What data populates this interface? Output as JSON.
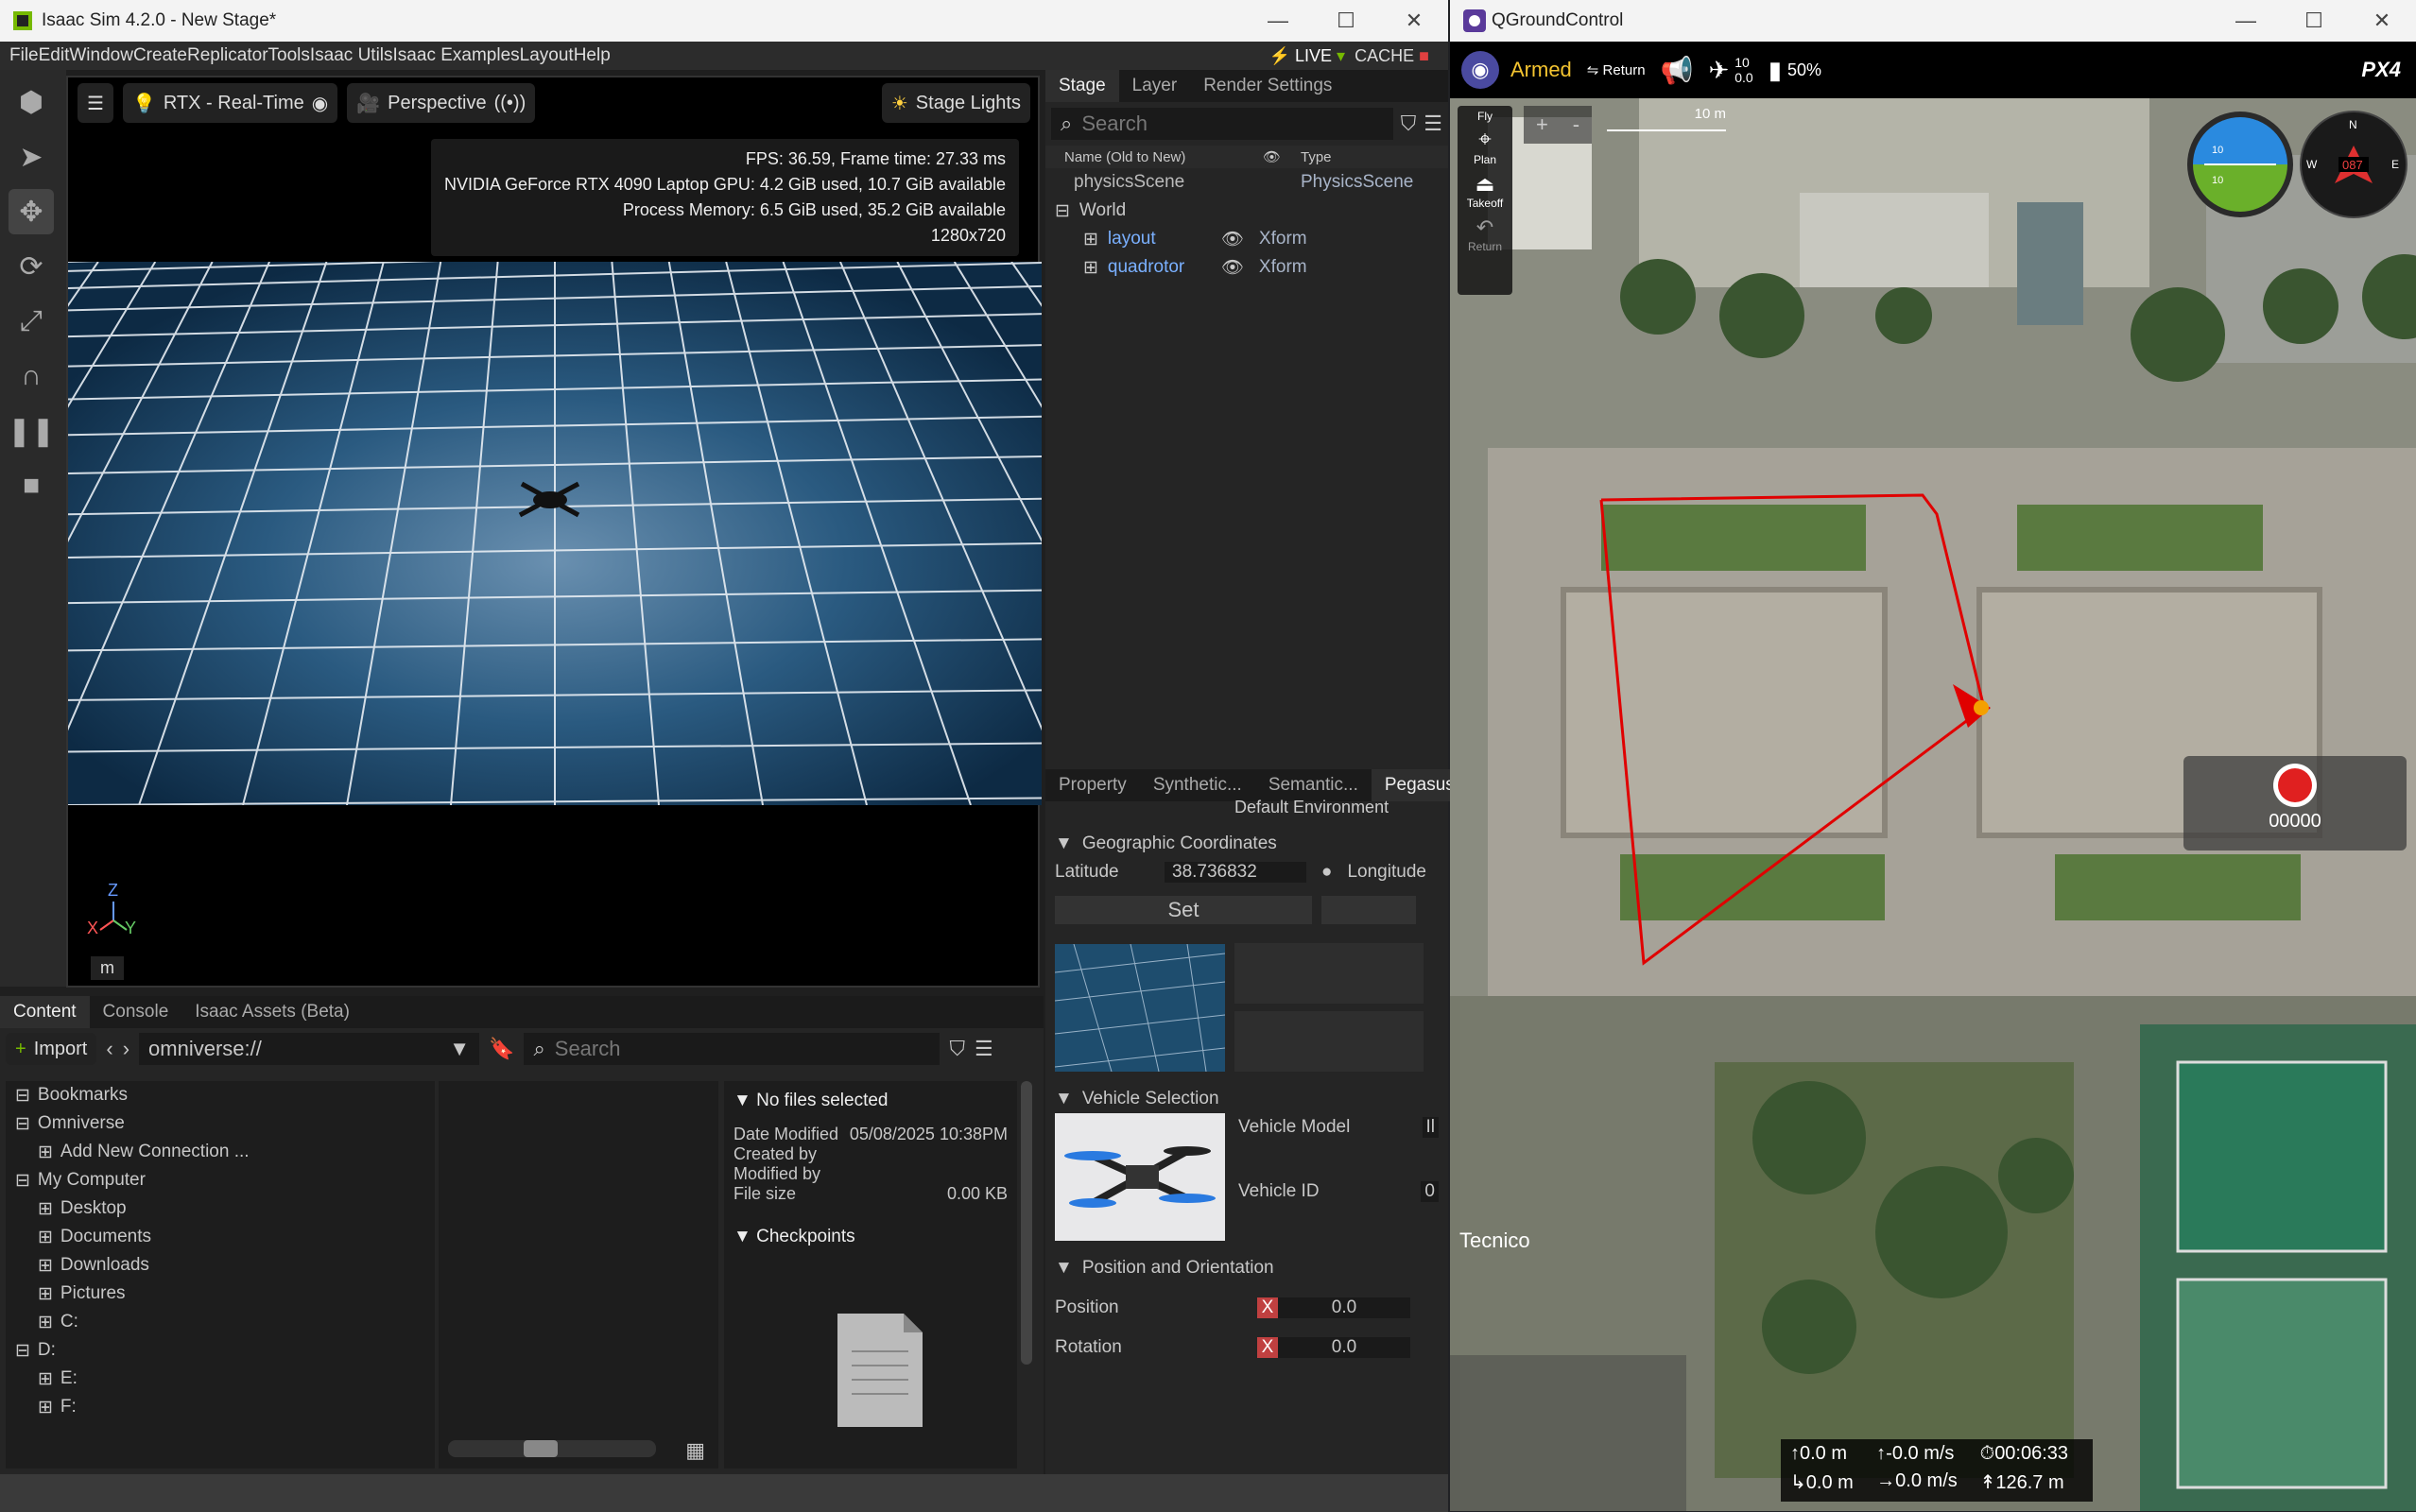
{
  "isaac": {
    "title": "Isaac Sim 4.2.0 - New Stage*",
    "menu": [
      "File",
      "Edit",
      "Window",
      "Create",
      "Replicator",
      "Tools",
      "Isaac Utils",
      "Isaac Examples",
      "Layout",
      "Help"
    ],
    "live": "LIVE",
    "cache": "CACHE",
    "viewport": {
      "renderer": "RTX - Real-Time",
      "camera": "Perspective",
      "lights": "Stage Lights",
      "stats": [
        "FPS: 36.59, Frame time: 27.33 ms",
        "NVIDIA GeForce RTX 4090 Laptop GPU: 4.2 GiB used, 10.7 GiB available",
        "Process Memory: 6.5 GiB used, 35.2 GiB available",
        "1280x720"
      ],
      "axes": {
        "z": "Z",
        "x": "X",
        "y": "Y"
      },
      "unit": "m"
    },
    "stage": {
      "tabs": [
        "Stage",
        "Layer",
        "Render Settings"
      ],
      "search": "Search",
      "col_name": "Name (Old to New)",
      "col_type": "Type",
      "items": [
        {
          "name": "physicsScene",
          "type": "PhysicsScene"
        },
        {
          "name": "World",
          "type": ""
        },
        {
          "name": "layout",
          "type": "Xform"
        },
        {
          "name": "quadrotor",
          "type": "Xform"
        }
      ]
    },
    "props": {
      "tabs": [
        "Property",
        "Synthetic...",
        "Semantic...",
        "Pegasus..."
      ],
      "env_partial": "Default Environment",
      "geo_header": "Geographic Coordinates",
      "lat_label": "Latitude",
      "lat_value": "38.736832",
      "lon_label": "Longitude",
      "set": "Set",
      "vehicle_header": "Vehicle Selection",
      "vehicle_model": "Vehicle Model",
      "vehicle_id": "Vehicle ID",
      "vehicle_model_partial": "Il",
      "vehicle_id_partial": "0",
      "pos_header": "Position and Orientation",
      "position": "Position",
      "rotation": "Rotation",
      "pos_val": "0.0",
      "rot_val": "0.0",
      "x": "X"
    },
    "content": {
      "tabs": [
        "Content",
        "Console",
        "Isaac Assets (Beta)"
      ],
      "import": "Import",
      "path": "omniverse://",
      "search": "Search",
      "tree": [
        {
          "label": "Bookmarks",
          "indent": 0
        },
        {
          "label": "Omniverse",
          "indent": 0
        },
        {
          "label": "Add New Connection ...",
          "indent": 1
        },
        {
          "label": "My Computer",
          "indent": 0
        },
        {
          "label": "Desktop",
          "indent": 1
        },
        {
          "label": "Documents",
          "indent": 1
        },
        {
          "label": "Downloads",
          "indent": 1
        },
        {
          "label": "Pictures",
          "indent": 1
        },
        {
          "label": "C:",
          "indent": 1
        },
        {
          "label": "D:",
          "indent": 0
        },
        {
          "label": "E:",
          "indent": 1
        },
        {
          "label": "F:",
          "indent": 1
        }
      ],
      "details": {
        "header": "No files selected",
        "date_label": "Date Modified",
        "date_value": "05/08/2025 10:38PM",
        "created": "Created by",
        "modified": "Modified by",
        "size_label": "File size",
        "size_value": "0.00 KB",
        "checkpoints": "Checkpoints"
      }
    }
  },
  "qgc": {
    "title": "QGroundControl",
    "status": "Armed",
    "return": "Return",
    "sats": "10",
    "hdop": "0.0",
    "battery": "50%",
    "brand": "PX4",
    "tools": [
      "Fly",
      "Plan",
      "Takeoff",
      "Return"
    ],
    "zoom_plus": "+",
    "zoom_minus": "-",
    "scale": "10 m",
    "compass": "087",
    "att_top": "10",
    "att_bot": "10",
    "record_count": "00000",
    "map_label": "Tecnico",
    "telemetry": {
      "alt": "0.0 m",
      "vspeed": "-0.0 m/s",
      "time": "00:06:33",
      "dist": "0.0 m",
      "hspeed": "0.0 m/s",
      "home": "126.7 m"
    },
    "colors": {
      "path": "#e00000",
      "armed": "#f4c430"
    }
  }
}
